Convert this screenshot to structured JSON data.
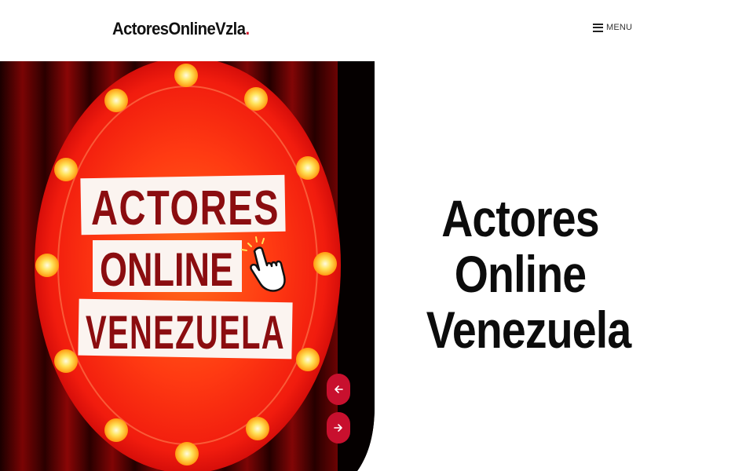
{
  "header": {
    "logo_text": "ActoresOnlineVzla",
    "logo_dot": ".",
    "menu_label": "MENU"
  },
  "hero": {
    "image_lines": [
      "ACTORES",
      "ONLINE",
      "VENEZUELA"
    ],
    "title": "Actores Online Venezuela"
  },
  "colors": {
    "accent": "#c8102e",
    "logo_dot": "#d0192d",
    "text": "#0c0c0c"
  },
  "icons": {
    "menu": "hamburger-icon",
    "prev": "arrow-left-icon",
    "next": "arrow-right-icon",
    "pointer": "hand-pointer-icon"
  }
}
